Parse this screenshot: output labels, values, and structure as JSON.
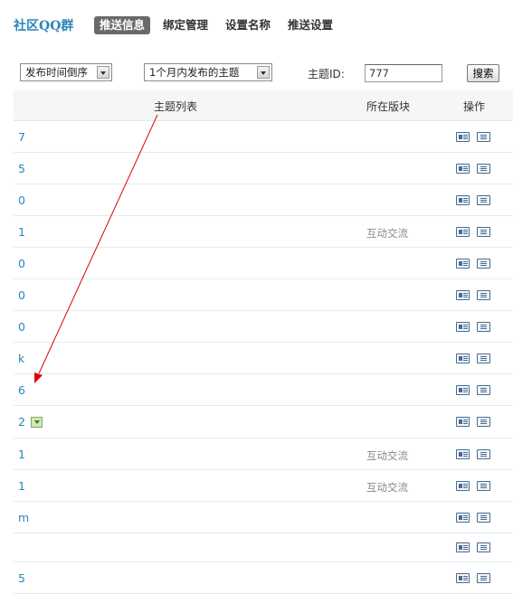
{
  "header": {
    "title": "社区QQ群",
    "tabs": [
      {
        "label": "推送信息",
        "active": true
      },
      {
        "label": "绑定管理",
        "active": false
      },
      {
        "label": "设置名称",
        "active": false
      },
      {
        "label": "推送设置",
        "active": false
      }
    ]
  },
  "filters": {
    "sort_select": "发布时间倒序",
    "range_select": "1个月内发布的主题",
    "id_label": "主题ID:",
    "id_value": "777",
    "search_label": "搜索"
  },
  "table": {
    "columns": {
      "topic": "主题列表",
      "board": "所在版块",
      "ops": "操作"
    },
    "rows": [
      {
        "topic": "7",
        "board": "",
        "attachment": false
      },
      {
        "topic": "5",
        "board": "",
        "attachment": false
      },
      {
        "topic": "0",
        "board": "",
        "attachment": false
      },
      {
        "topic": "1",
        "board": "互动交流",
        "attachment": false
      },
      {
        "topic": "0",
        "board": "",
        "attachment": false
      },
      {
        "topic": "0",
        "board": "",
        "attachment": false
      },
      {
        "topic": "0",
        "board": "",
        "attachment": false
      },
      {
        "topic": "k",
        "board": "",
        "attachment": false
      },
      {
        "topic": "6",
        "board": "",
        "attachment": false
      },
      {
        "topic": "2",
        "board": "",
        "attachment": true
      },
      {
        "topic": "1",
        "board": "互动交流",
        "attachment": false
      },
      {
        "topic": "1",
        "board": "互动交流",
        "attachment": false
      },
      {
        "topic": "m",
        "board": "",
        "attachment": false
      },
      {
        "topic": "",
        "board": "",
        "attachment": false
      },
      {
        "topic": "5",
        "board": "",
        "attachment": false
      }
    ]
  },
  "colors": {
    "accent": "#2a86b8",
    "active_tab_bg": "#6a6a6a",
    "annotation_arrow": "#e00000"
  },
  "icons": {
    "op_preview": "card-view-icon",
    "op_list": "list-view-icon",
    "attachment": "download-attachment-icon"
  }
}
